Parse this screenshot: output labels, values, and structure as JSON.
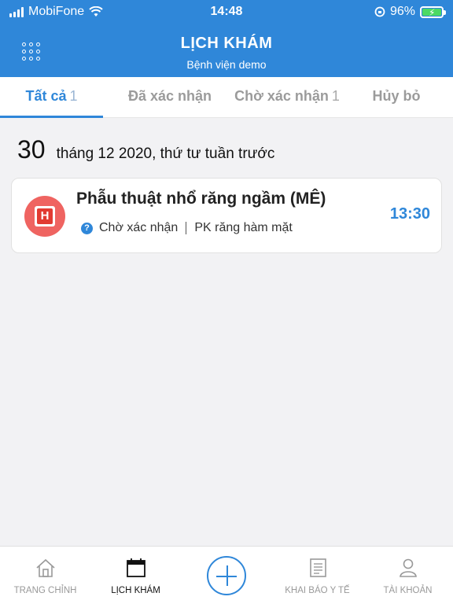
{
  "status_bar": {
    "carrier": "MobiFone",
    "time": "14:48",
    "battery": "96%"
  },
  "header": {
    "title": "LỊCH KHÁM",
    "subtitle": "Bệnh viện demo"
  },
  "tabs": [
    {
      "label": "Tất cả",
      "count": "1"
    },
    {
      "label": "Đã xác nhận",
      "count": ""
    },
    {
      "label": "Chờ xác nhận",
      "count": "1"
    },
    {
      "label": "Hủy bỏ",
      "count": ""
    }
  ],
  "date_group": {
    "day": "30",
    "text": "tháng 12 2020, thứ tư tuần trước"
  },
  "appointment": {
    "title": "Phẫu thuật nhổ răng ngầm (MÊ)",
    "status": "Chờ xác nhận",
    "department": "PK răng hàm mặt",
    "time": "13:30",
    "logo_letter": "H"
  },
  "bottom_nav": [
    {
      "label": "TRANG CHỈNH"
    },
    {
      "label": "LỊCH KHÁM"
    },
    {
      "label": "KHAI BÁO Y TẾ"
    },
    {
      "label": "TÀI KHOẢN"
    }
  ],
  "colors": {
    "primary": "#2f87d9",
    "hospital_red": "#e23b32",
    "background": "#f2f2f4"
  }
}
